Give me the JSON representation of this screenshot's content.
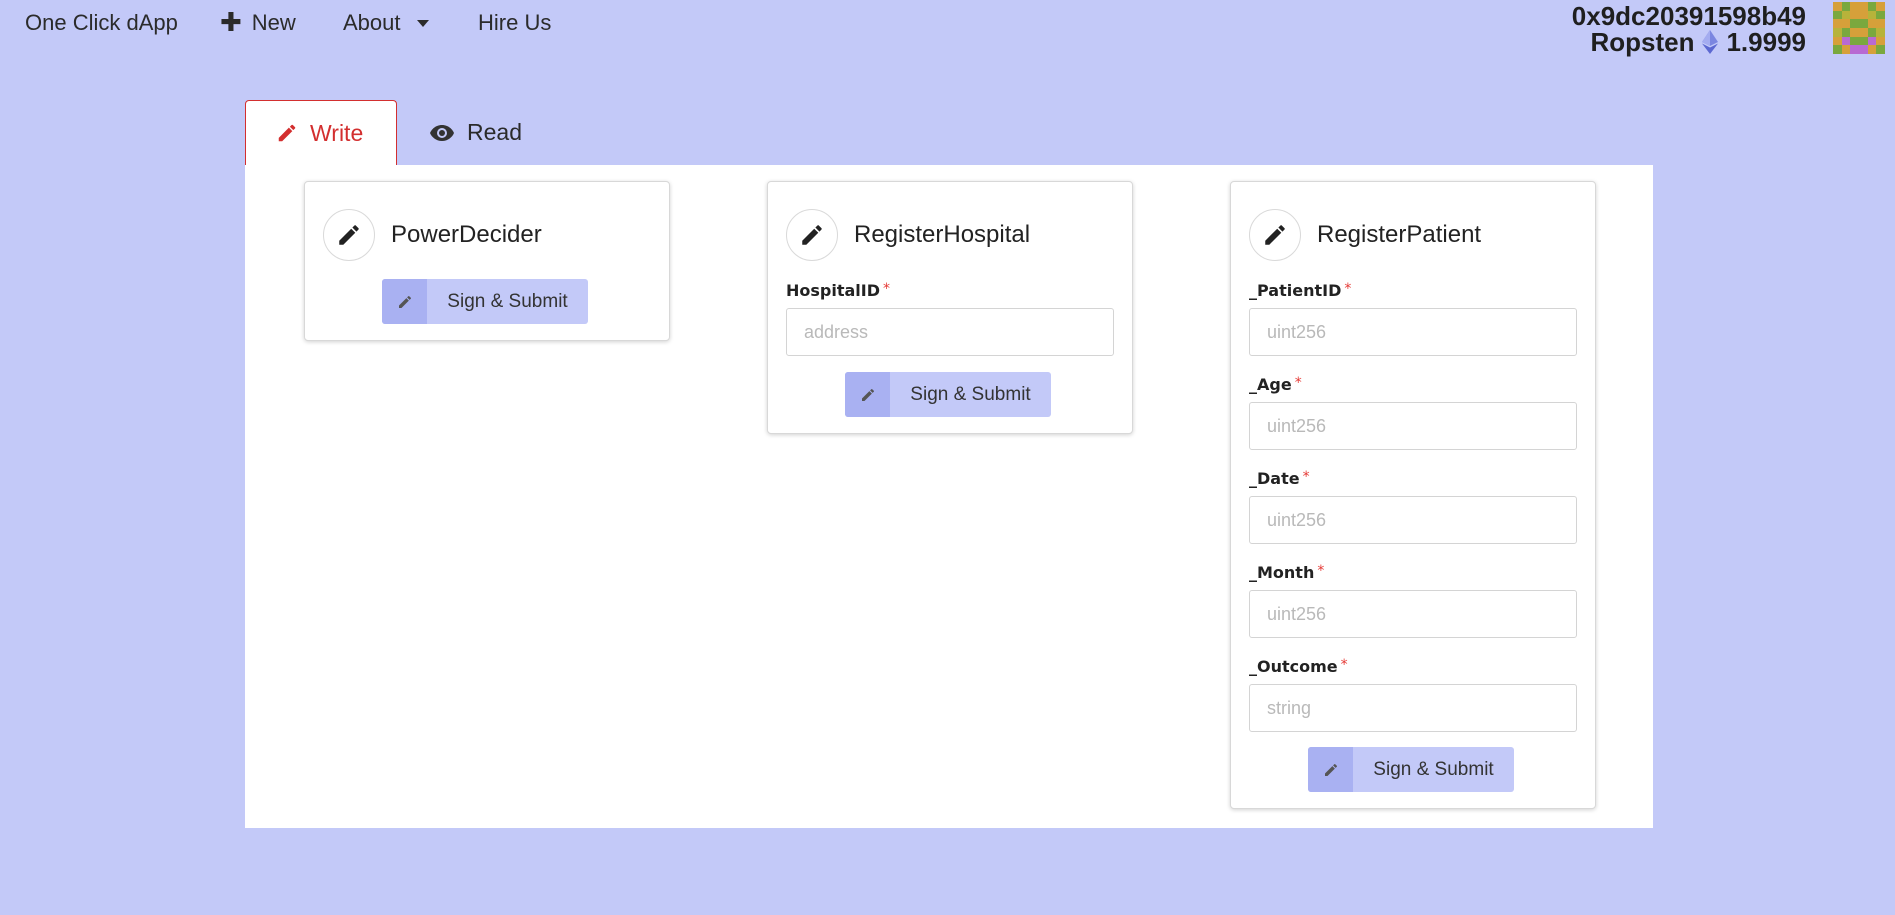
{
  "nav": {
    "brand": "One Click dApp",
    "new_label": "New",
    "about_label": "About",
    "hire_label": "Hire Us"
  },
  "account": {
    "address": "0x9dc20391598b49",
    "network": "Ropsten",
    "balance": "1.9999"
  },
  "tabs": [
    {
      "label": "Write",
      "icon": "pencil-icon",
      "active": true
    },
    {
      "label": "Read",
      "icon": "eye-icon",
      "active": false
    }
  ],
  "cards": [
    {
      "title": "PowerDecider",
      "fields": [],
      "submit_label": "Sign & Submit"
    },
    {
      "title": "RegisterHospital",
      "fields": [
        {
          "label": "HospitalID",
          "required": "*",
          "placeholder": "address"
        }
      ],
      "submit_label": "Sign & Submit"
    },
    {
      "title": "RegisterPatient",
      "fields": [
        {
          "label": "_PatientID",
          "required": "*",
          "placeholder": "uint256"
        },
        {
          "label": "_Age",
          "required": "*",
          "placeholder": "uint256"
        },
        {
          "label": "_Date",
          "required": "*",
          "placeholder": "uint256"
        },
        {
          "label": "_Month",
          "required": "*",
          "placeholder": "uint256"
        },
        {
          "label": "_Outcome",
          "required": "*",
          "placeholder": "string"
        }
      ],
      "submit_label": "Sign & Submit"
    }
  ],
  "colors": {
    "background": "#c3c9f8",
    "active_tab": "#d32f2f",
    "button": "#c3c9f8",
    "button_icon_bg": "#a9b1f2",
    "required": "#e53935"
  }
}
